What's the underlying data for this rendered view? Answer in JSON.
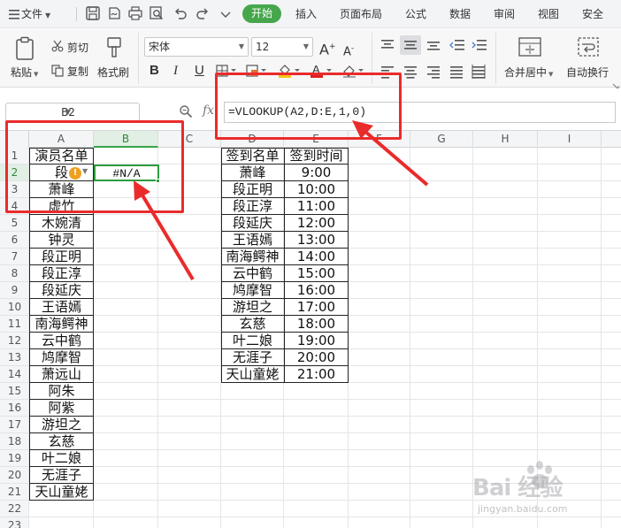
{
  "menubar": {
    "file_label": "文件",
    "tabs": [
      {
        "label": "开始",
        "active": true
      },
      {
        "label": "插入"
      },
      {
        "label": "页面布局"
      },
      {
        "label": "公式"
      },
      {
        "label": "数据"
      },
      {
        "label": "审阅"
      },
      {
        "label": "视图"
      },
      {
        "label": "安全"
      }
    ]
  },
  "ribbon": {
    "paste_label": "粘贴",
    "cut_label": "剪切",
    "copy_label": "复制",
    "format_painter_label": "格式刷",
    "font_name": "宋体",
    "font_size": "12",
    "bold": "B",
    "italic": "I",
    "underline": "U",
    "merge_center_label": "合并居中",
    "wrap_text_label": "自动换行"
  },
  "formula_bar": {
    "name_box": "B2",
    "fx_label": "fx",
    "formula": "=VLOOKUP(A2,D:E,1,0)"
  },
  "grid": {
    "columns": [
      "A",
      "B",
      "C",
      "D",
      "E",
      "F",
      "G",
      "H",
      "I"
    ],
    "rows": [
      "1",
      "2",
      "3",
      "4",
      "5",
      "6",
      "7",
      "8",
      "9",
      "10",
      "11",
      "12",
      "13",
      "14",
      "15",
      "16",
      "17",
      "18",
      "19",
      "20",
      "21",
      "22",
      "23"
    ],
    "col_a": [
      "演员名单",
      "段",
      "萧峰",
      "虚竹",
      "木婉清",
      "钟灵",
      "段正明",
      "段正淳",
      "段延庆",
      "王语嫣",
      "南海鳄神",
      "云中鹤",
      "鸠摩智",
      "萧远山",
      "阿朱",
      "阿紫",
      "游坦之",
      "玄慈",
      "叶二娘",
      "无涯子",
      "天山童姥"
    ],
    "b2_value": "#N/A",
    "col_d": [
      "签到名单",
      "萧峰",
      "段正明",
      "段正淳",
      "段延庆",
      "王语嫣",
      "南海鳄神",
      "云中鹤",
      "鸠摩智",
      "游坦之",
      "玄慈",
      "叶二娘",
      "无涯子",
      "天山童姥"
    ],
    "col_e": [
      "签到时间",
      "9:00",
      "10:00",
      "11:00",
      "12:00",
      "13:00",
      "14:00",
      "15:00",
      "16:00",
      "17:00",
      "18:00",
      "19:00",
      "20:00",
      "21:00"
    ],
    "error_icon": "!"
  },
  "colors": {
    "accent_green": "#46a64c",
    "annotation_red": "#ea2b2b"
  },
  "watermark": {
    "brand": "Bai 经验",
    "url": "jingyan.baidu.com"
  }
}
